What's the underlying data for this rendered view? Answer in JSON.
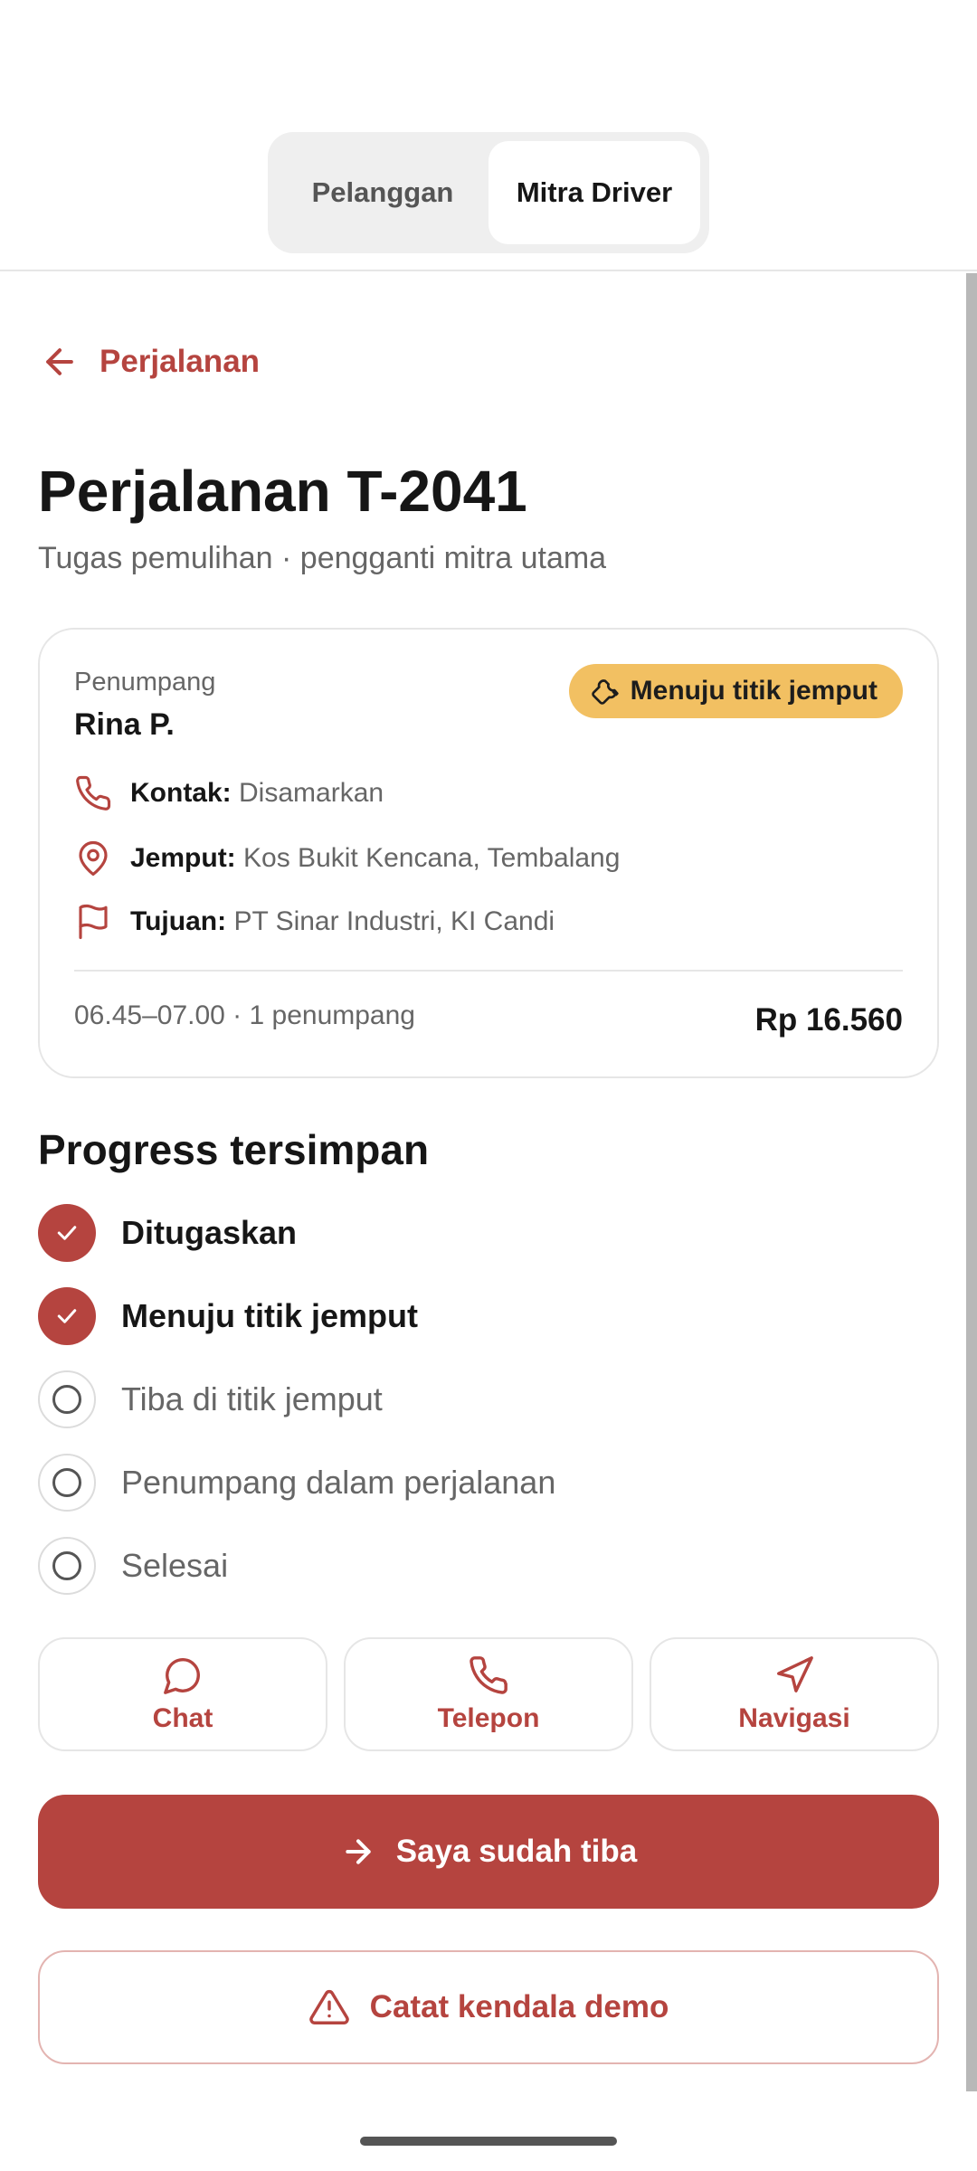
{
  "switcher": {
    "tabs": [
      "Pelanggan",
      "Mitra Driver"
    ],
    "active": "Mitra Driver"
  },
  "back": {
    "label": "Perjalanan"
  },
  "trip": {
    "title": "Perjalanan T-2041",
    "subtitle": "Tugas pemulihan · pengganti mitra utama"
  },
  "card": {
    "passenger_label": "Penumpang",
    "passenger_name": "Rina P.",
    "status_badge": "Menuju titik jemput",
    "contact_label": "Kontak:",
    "contact_value": "Disamarkan",
    "pickup_label": "Jemput:",
    "pickup_value": "Kos Bukit Kencana, Tembalang",
    "destination_label": "Tujuan:",
    "destination_value": "PT Sinar Industri, KI Candi",
    "schedule": "06.45–07.00 · 1 penumpang",
    "price": "Rp 16.560"
  },
  "progress": {
    "title": "Progress tersimpan",
    "steps": [
      {
        "label": "Ditugaskan",
        "done": true
      },
      {
        "label": "Menuju titik jemput",
        "done": true
      },
      {
        "label": "Tiba di titik jemput",
        "done": false
      },
      {
        "label": "Penumpang dalam perjalanan",
        "done": false
      },
      {
        "label": "Selesai",
        "done": false
      }
    ]
  },
  "actions": {
    "chat": "Chat",
    "phone": "Telepon",
    "navigate": "Navigasi"
  },
  "primary_button": "Saya sudah tiba",
  "secondary_button": "Catat kendala demo",
  "colors": {
    "accent": "#b5443f",
    "badge": "#f2c062"
  }
}
